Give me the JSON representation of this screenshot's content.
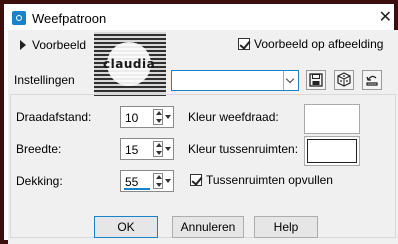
{
  "window": {
    "title": "Weefpatroon",
    "close_glyph": "✕"
  },
  "preview": {
    "label": "Voorbeeld",
    "thumbnail_text": "claudia",
    "show_on_image_label": "Voorbeeld op afbeelding",
    "show_on_image_checked": true
  },
  "settings": {
    "label": "Instellingen",
    "preset_value": "",
    "toolbar": {
      "save_icon": "save-icon",
      "random_icon": "dice-icon",
      "reset_icon": "reset-icon"
    }
  },
  "fields": {
    "gap_label": "Draadafstand:",
    "gap_value": "10",
    "width_label": "Breedte:",
    "width_value": "15",
    "opacity_label": "Dekking:",
    "opacity_value": "55",
    "weave_color_label": "Kleur weefdraad:",
    "weave_color": "#ffffff",
    "gap_color_label": "Kleur tussenruimten:",
    "gap_color": "#ffffff",
    "fill_gaps_label": "Tussenruimten opvullen",
    "fill_gaps_checked": true
  },
  "buttons": {
    "ok": "OK",
    "cancel": "Annuleren",
    "help": "Help"
  },
  "colors": {
    "border": "#3c0e0e",
    "accent": "#1a82c8",
    "dialog_bg": "#f0f0f0"
  }
}
